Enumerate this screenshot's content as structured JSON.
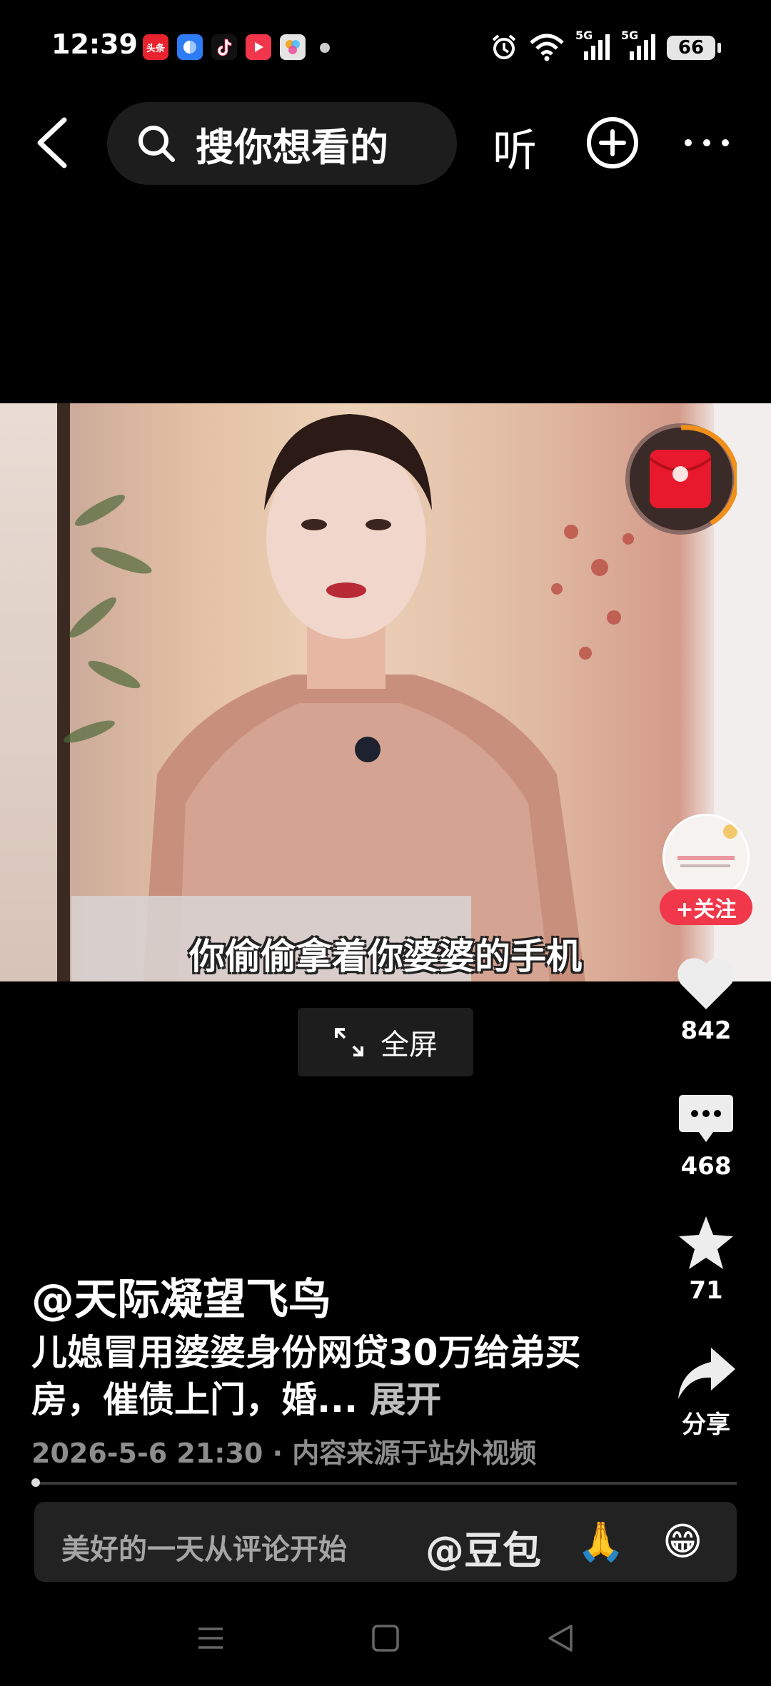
{
  "status_bar": {
    "time": "12:39",
    "apps": [
      {
        "name": "toutiao-app-icon",
        "label": "头条",
        "color": "#e8232e"
      },
      {
        "name": "blue-app-icon",
        "label": "",
        "color": "#2d7cf6"
      },
      {
        "name": "tiktok-app-icon",
        "label": "",
        "color": "#111111"
      },
      {
        "name": "video-app-icon",
        "label": "",
        "color": "#f0364a"
      },
      {
        "name": "colorful-app-icon",
        "label": "",
        "color": "#d8d8d8"
      }
    ],
    "network1": "5G",
    "network2": "5G",
    "battery": "66"
  },
  "nav": {
    "search_placeholder": "搜你想看的",
    "listen_label": "听"
  },
  "video": {
    "subtitle": "你偷偷拿着你婆婆的手机"
  },
  "fullscreen": {
    "label": "全屏"
  },
  "rail": {
    "follow_label": "+关注",
    "like_count": "842",
    "comment_count": "468",
    "favorite_count": "71",
    "share_label": "分享"
  },
  "post": {
    "author": "@天际凝望飞鸟",
    "caption": "儿媳冒用婆婆身份网贷30万给弟买房，催债上门，婚...",
    "expand_label": "展开",
    "meta": "2026-5-6 21:30 · 内容来源于站外视频",
    "progress": 0
  },
  "comment_bar": {
    "placeholder": "美好的一天从评论开始",
    "mention": "@豆包",
    "emoji1": "🙏",
    "emoji2": "😁"
  },
  "colors": {
    "accent_red": "#f0384a",
    "background": "#000000"
  }
}
